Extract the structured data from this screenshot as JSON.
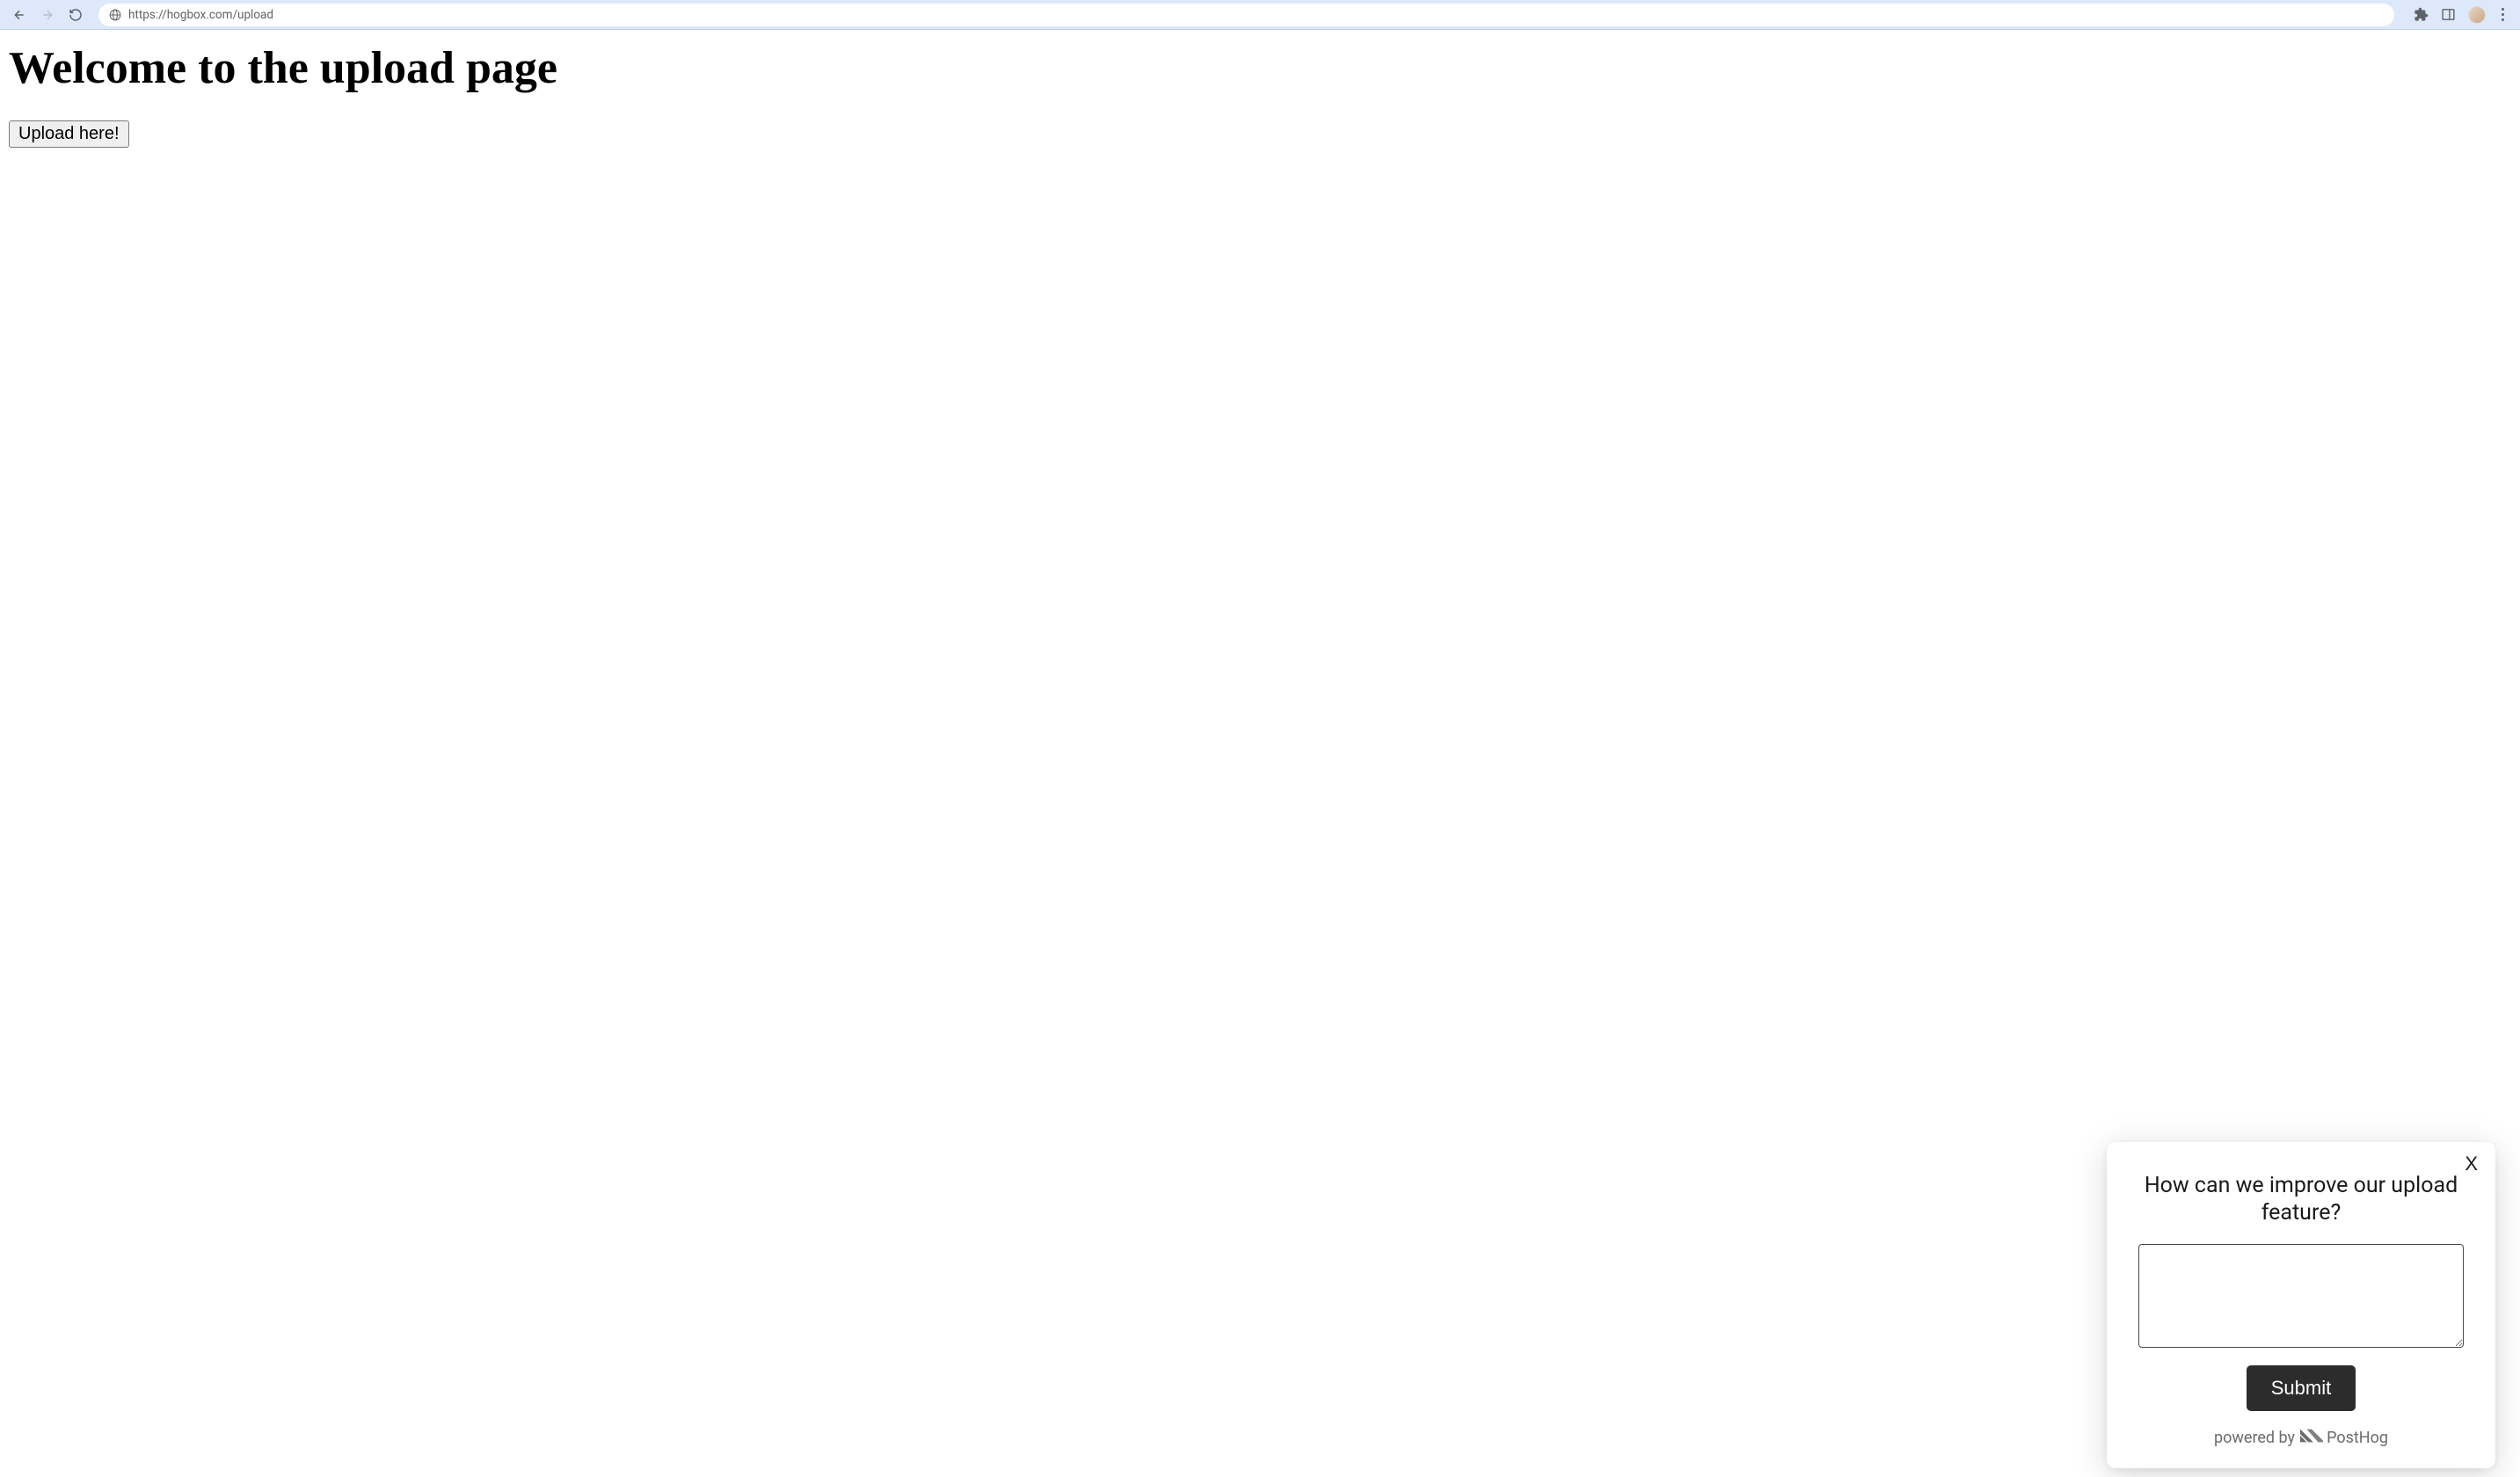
{
  "browser": {
    "url": "https://hogbox.com/upload"
  },
  "page": {
    "title": "Welcome to the upload page",
    "upload_button_label": "Upload here!"
  },
  "survey": {
    "close_label": "X",
    "question": "How can we improve our upload feature?",
    "textarea_value": "",
    "submit_label": "Submit",
    "powered_by_text": "powered by",
    "brand_name": "PostHog"
  }
}
